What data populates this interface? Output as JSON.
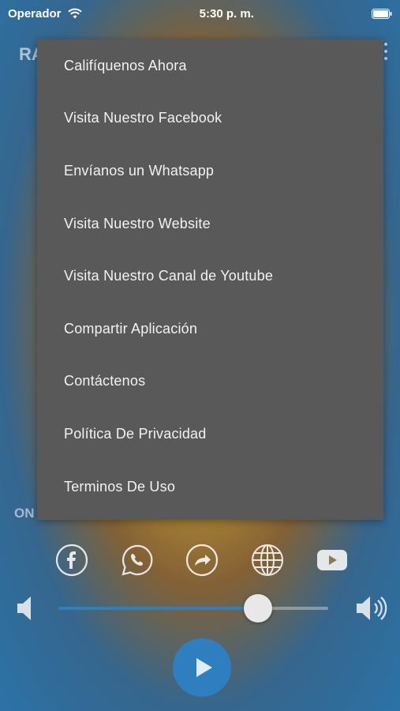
{
  "status_bar": {
    "carrier": "Operador",
    "time": "5:30 p. m."
  },
  "background": {
    "app_title_partial": "RA",
    "status_text_partial": "ON"
  },
  "menu": {
    "items": [
      "Califíquenos Ahora",
      "Visita Nuestro Facebook",
      "Envíanos un Whatsapp",
      "Visita Nuestro Website",
      "Visita Nuestro Canal de Youtube",
      "Compartir Aplicación",
      "Contáctenos",
      "Política De Privacidad",
      "Terminos De Uso"
    ]
  },
  "social_icons": [
    "facebook-icon",
    "whatsapp-icon",
    "share-icon",
    "globe-icon",
    "youtube-icon"
  ],
  "volume": {
    "level": 0.74
  },
  "colors": {
    "accent": "#2f7fc0",
    "menu_bg": "#595959"
  }
}
